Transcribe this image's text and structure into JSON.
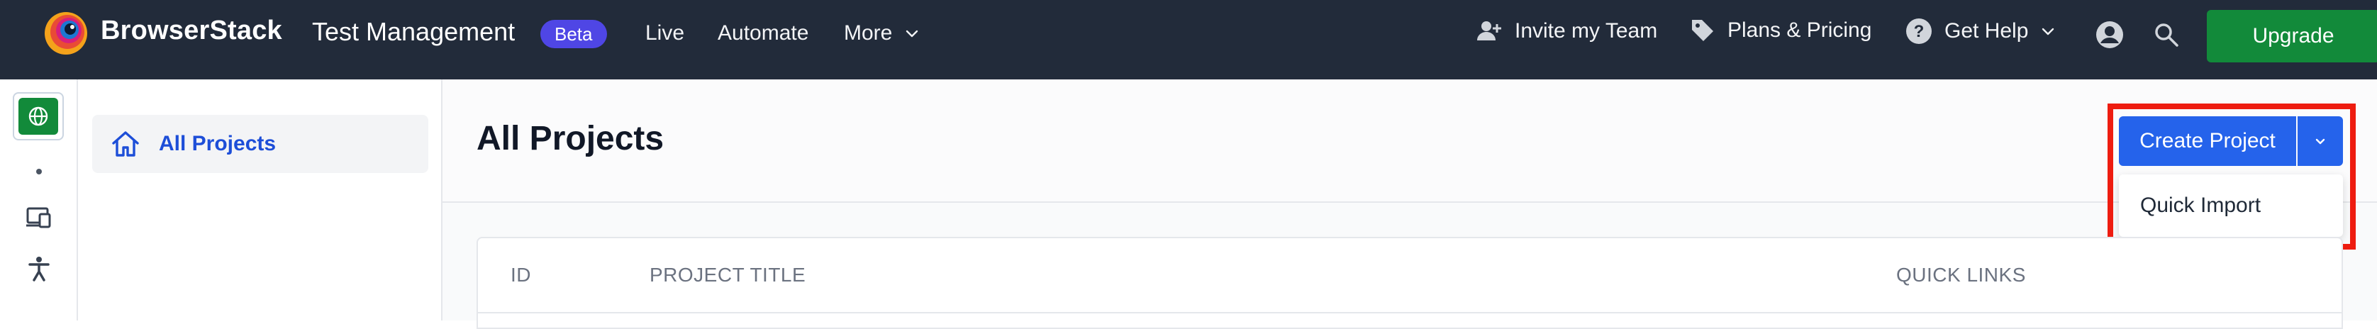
{
  "nav": {
    "brand": "BrowserStack",
    "product": "Test Management",
    "badge": "Beta",
    "links": [
      "Live",
      "Automate",
      "More"
    ],
    "invite": "Invite my Team",
    "plans": "Plans & Pricing",
    "help": "Get Help",
    "upgrade": "Upgrade"
  },
  "sidebar": {
    "items": [
      {
        "label": "All Projects",
        "icon": "home-icon"
      }
    ]
  },
  "main": {
    "title": "All Projects",
    "create_button": "Create Project",
    "dropdown_item": "Quick Import",
    "table": {
      "columns": [
        "ID",
        "PROJECT TITLE",
        "QUICK LINKS"
      ]
    }
  },
  "colors": {
    "nav_bg": "#222b3a",
    "primary": "#2563eb",
    "upgrade": "#128a3a",
    "badge": "#4f46e5",
    "highlight": "#ee1c10"
  }
}
